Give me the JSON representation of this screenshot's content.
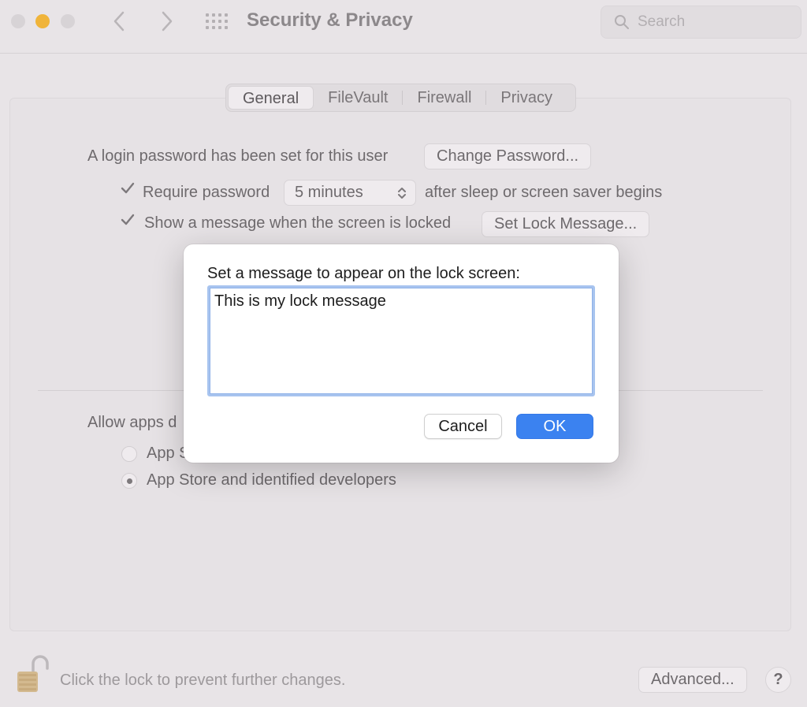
{
  "window": {
    "title": "Security & Privacy",
    "search_placeholder": "Search"
  },
  "tabs": [
    {
      "label": "General",
      "active": true
    },
    {
      "label": "FileVault",
      "active": false
    },
    {
      "label": "Firewall",
      "active": false
    },
    {
      "label": "Privacy",
      "active": false
    }
  ],
  "general": {
    "login_text": "A login password has been set for this user",
    "change_password_label": "Change Password...",
    "require_password_label": "Require password",
    "require_password_checked": true,
    "require_password_delay": "5 minutes",
    "after_sleep_text": "after sleep or screen saver begins",
    "show_message_label": "Show a message when the screen is locked",
    "show_message_checked": true,
    "set_lock_message_label": "Set Lock Message...",
    "allow_apps_text": "Allow apps d",
    "radio_app_store_partial": "App S",
    "radio_identified": "App Store and identified developers"
  },
  "footer": {
    "lock_text": "Click the lock to prevent further changes.",
    "advanced_label": "Advanced...",
    "help_label": "?"
  },
  "sheet": {
    "prompt": "Set a message to appear on the lock screen:",
    "message_value": "This is my lock message",
    "cancel_label": "Cancel",
    "ok_label": "OK"
  },
  "colors": {
    "accent": "#3b82f0",
    "minimize": "#f0b43a",
    "focus_ring": "#a8c4ef"
  },
  "icons": [
    "close-button",
    "minimize-button",
    "zoom-button",
    "chevron-left-icon",
    "chevron-right-icon",
    "grid-icon",
    "search-icon",
    "checkmark-icon",
    "updown-arrows-icon",
    "unlocked-padlock-icon",
    "help-icon"
  ]
}
